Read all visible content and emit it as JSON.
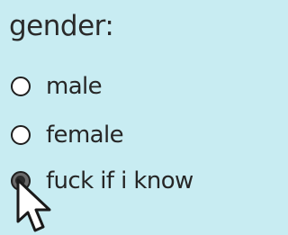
{
  "field": {
    "label": "gender:"
  },
  "options": [
    {
      "label": "male",
      "checked": false
    },
    {
      "label": "female",
      "checked": false
    },
    {
      "label": "fuck if i know",
      "checked": true
    }
  ],
  "colors": {
    "background": "#c8ecf2",
    "text": "#262626"
  },
  "icons": {
    "cursor": "arrow-pointer-icon"
  }
}
